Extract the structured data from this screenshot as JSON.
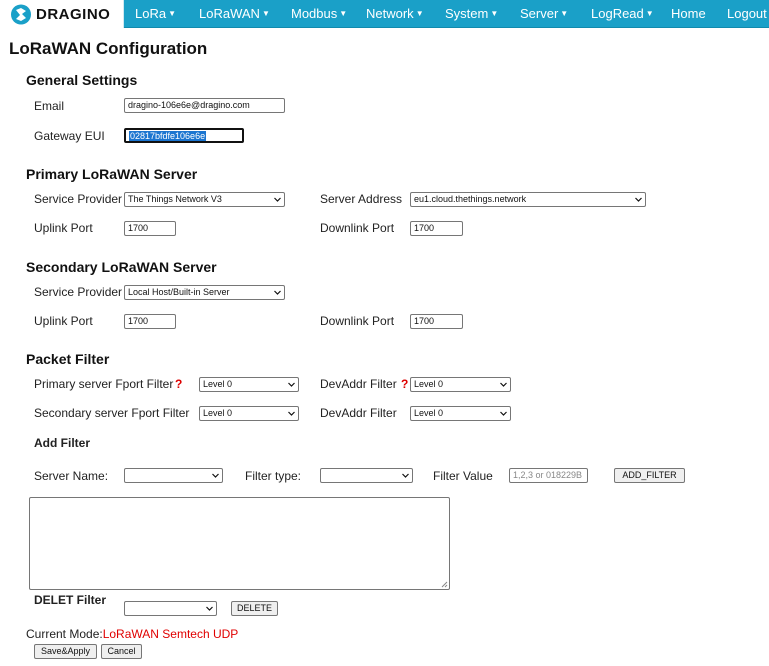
{
  "nav": {
    "logo_text": "DRAGINO",
    "items": [
      {
        "label": "LoRa",
        "caret": "▼"
      },
      {
        "label": "LoRaWAN",
        "caret": "▼"
      },
      {
        "label": "Modbus",
        "caret": "▼"
      },
      {
        "label": "Network",
        "caret": "▼"
      },
      {
        "label": "System",
        "caret": "▼"
      },
      {
        "label": "Server",
        "caret": "▼"
      },
      {
        "label": "LogRead",
        "caret": "▼"
      },
      {
        "label": "Home"
      },
      {
        "label": "Logout"
      }
    ],
    "colors": {
      "bar": "#1aa0c8",
      "text": "#ffffff"
    }
  },
  "page": {
    "title": "LoRaWAN Configuration"
  },
  "general": {
    "title": "General Settings",
    "email_label": "Email",
    "email_value": "dragino-106e6e@dragino.com",
    "eui_label": "Gateway EUI",
    "eui_value": "02817bfdfe106e6e"
  },
  "primary": {
    "title": "Primary LoRaWAN Server",
    "provider_label": "Service Provider",
    "provider_value": "The Things Network V3",
    "address_label": "Server Address",
    "address_value": "eu1.cloud.thethings.network",
    "uplink_label": "Uplink Port",
    "uplink_value": "1700",
    "downlink_label": "Downlink Port",
    "downlink_value": "1700"
  },
  "secondary": {
    "title": "Secondary LoRaWAN Server",
    "provider_label": "Service Provider",
    "provider_value": "Local Host/Built-in Server",
    "uplink_label": "Uplink Port",
    "uplink_value": "1700",
    "downlink_label": "Downlink Port",
    "downlink_value": "1700"
  },
  "packet_filter": {
    "title": "Packet Filter",
    "primary_fport_label": "Primary server Fport Filter",
    "primary_fport_value": "Level 0",
    "primary_devaddr_label": "DevAddr Filter",
    "primary_devaddr_value": "Level 0",
    "secondary_fport_label": "Secondary server Fport Filter",
    "secondary_fport_value": "Level 0",
    "secondary_devaddr_label": "DevAddr Filter",
    "secondary_devaddr_value": "Level 0",
    "help_mark": "?"
  },
  "add_filter": {
    "title": "Add Filter",
    "server_name_label": "Server Name:",
    "server_name_value": "",
    "filter_type_label": "Filter type:",
    "filter_type_value": "",
    "filter_value_label": "Filter Value",
    "filter_value_placeholder": "1,2,3 or 018229B",
    "add_button": "ADD_FILTER"
  },
  "delete_filter": {
    "title": "DELET Filter",
    "select_value": "",
    "delete_button": "DELETE"
  },
  "status": {
    "mode_label": "Current Mode:",
    "mode_value": "LoRaWAN Semtech UDP",
    "mode_color": "#e00000"
  },
  "actions": {
    "save_label": "Save&Apply",
    "cancel_label": "Cancel"
  }
}
